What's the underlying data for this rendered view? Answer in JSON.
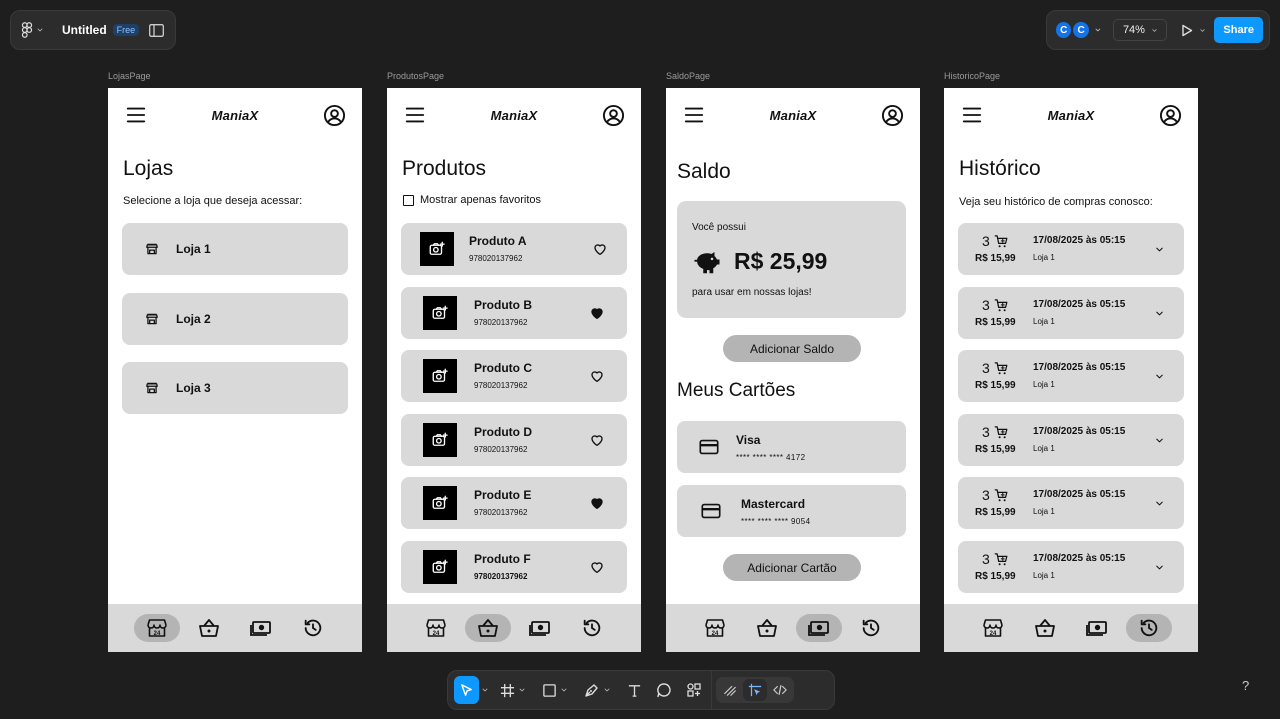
{
  "app": {
    "file_title": "Untitled",
    "plan_badge": "Free",
    "avatars": [
      "C",
      "C"
    ],
    "zoom": "74%",
    "share_label": "Share",
    "help": "?"
  },
  "brand": "ManiaX",
  "frames": {
    "lojas": {
      "label": "LojasPage",
      "title": "Lojas",
      "subtitle": "Selecione a loja que deseja acessar:",
      "stores": [
        "Loja 1",
        "Loja 2",
        "Loja 3"
      ]
    },
    "produtos": {
      "label": "ProdutosPage",
      "title": "Produtos",
      "filter_label": "Mostrar apenas favoritos",
      "products": [
        {
          "name": "Produto A",
          "code": "978020137962",
          "favorite": false
        },
        {
          "name": "Produto B",
          "code": "978020137962",
          "favorite": true
        },
        {
          "name": "Produto C",
          "code": "978020137962",
          "favorite": false
        },
        {
          "name": "Produto D",
          "code": "978020137962",
          "favorite": false
        },
        {
          "name": "Produto E",
          "code": "978020137962",
          "favorite": true
        },
        {
          "name": "Produto F",
          "code": "978020137962",
          "favorite": false
        }
      ]
    },
    "saldo": {
      "label": "SaldoPage",
      "title": "Saldo",
      "balance_intro": "Você possui",
      "balance_amount": "R$ 25,99",
      "balance_outro": "para usar em nossas lojas!",
      "add_balance": "Adicionar Saldo",
      "cards_title": "Meus Cartões",
      "cards": [
        {
          "name": "Visa",
          "number": "****  ****  ****  4172"
        },
        {
          "name": "Mastercard",
          "number": "****  ****  ****  9054"
        }
      ],
      "add_card": "Adicionar Cartão"
    },
    "historico": {
      "label": "HistoricoPage",
      "title": "Histórico",
      "subtitle": "Veja seu histórico de compras conosco:",
      "entries": [
        {
          "qty": "3",
          "price": "R$ 15,99",
          "date": "17/08/2025 às 05:15",
          "store": "Loja 1"
        },
        {
          "qty": "3",
          "price": "R$ 15,99",
          "date": "17/08/2025 às 05:15",
          "store": "Loja 1"
        },
        {
          "qty": "3",
          "price": "R$ 15,99",
          "date": "17/08/2025 às 05:15",
          "store": "Loja 1"
        },
        {
          "qty": "3",
          "price": "R$ 15,99",
          "date": "17/08/2025 às 05:15",
          "store": "Loja 1"
        },
        {
          "qty": "3",
          "price": "R$ 15,99",
          "date": "17/08/2025 às 05:15",
          "store": "Loja 1"
        },
        {
          "qty": "3",
          "price": "R$ 15,99",
          "date": "17/08/2025 às 05:15",
          "store": "Loja 1"
        }
      ]
    }
  },
  "nav_icons": [
    "store-icon",
    "basket-icon",
    "money-icon",
    "history-icon"
  ],
  "toolbar_tools": [
    "move-tool",
    "frame-tool",
    "shape-tool",
    "pen-tool",
    "text-tool",
    "comment-tool",
    "actions-tool"
  ],
  "colors": {
    "canvas": "#1e1e1e",
    "panel": "#2c2c2c",
    "accent": "#0d99ff",
    "card": "#d9d9d9",
    "active_pill": "#b4b4b4"
  }
}
